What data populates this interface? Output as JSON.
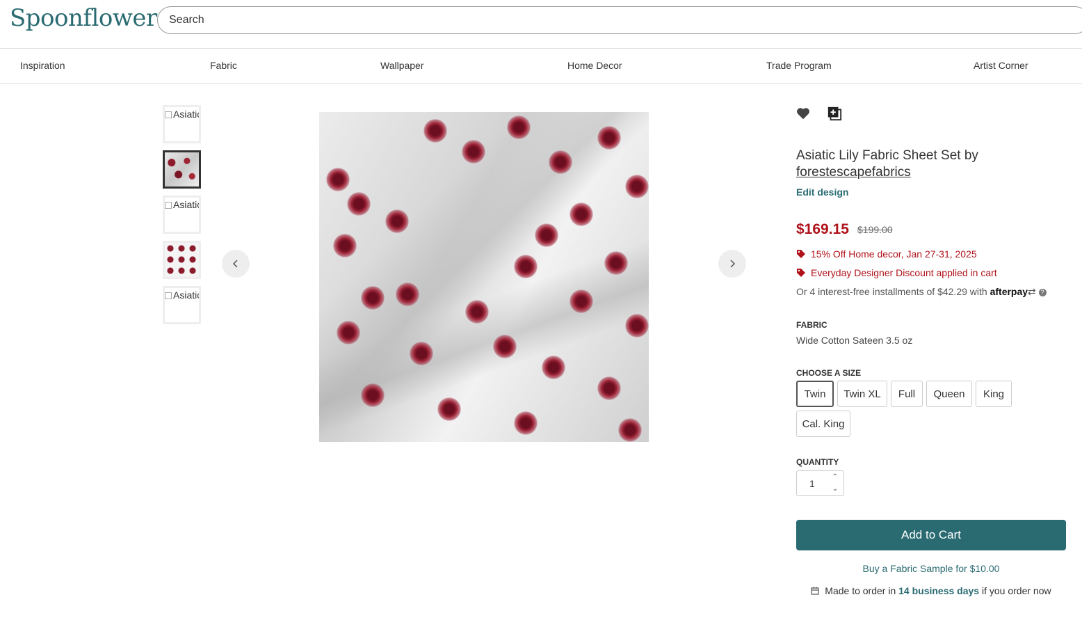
{
  "header": {
    "logo": "Spoonflower",
    "search_placeholder": "Search"
  },
  "nav": [
    "Inspiration",
    "Fabric",
    "Wallpaper",
    "Home Decor",
    "Trade Program",
    "Artist Corner"
  ],
  "gallery": {
    "thumb_alt": "Asiatic Lily Fabric Sheet Set",
    "selected_index": 1
  },
  "product": {
    "title_prefix": "Asiatic Lily Fabric Sheet Set by",
    "designer": "forestescapefabrics",
    "edit_link": "Edit design",
    "price": "$169.15",
    "original_price": "$199.00",
    "promos": [
      "15% Off Home decor, Jan 27-31, 2025",
      "Everyday Designer Discount applied in cart"
    ],
    "afterpay_text": "Or 4 interest-free installments of $42.29 with",
    "afterpay_brand": "afterpay",
    "fabric_label": "FABRIC",
    "fabric_value": "Wide Cotton Sateen 3.5 oz",
    "size_label": "CHOOSE A SIZE",
    "sizes": [
      "Twin",
      "Twin XL",
      "Full",
      "Queen",
      "King",
      "Cal. King"
    ],
    "selected_size": "Twin",
    "quantity_label": "QUANTITY",
    "quantity": "1",
    "add_to_cart": "Add to Cart",
    "sample_link": "Buy a Fabric Sample for $10.00",
    "made_prefix": "Made to order in",
    "made_days": "14 business days",
    "made_suffix": "if you order now"
  },
  "colors": {
    "brand": "#2a6b72",
    "sale": "#b0121a"
  },
  "icons": [
    "heart-icon",
    "add-to-collection-icon",
    "chevron-left-icon",
    "chevron-right-icon",
    "tag-icon",
    "calendar-icon",
    "help-icon"
  ]
}
